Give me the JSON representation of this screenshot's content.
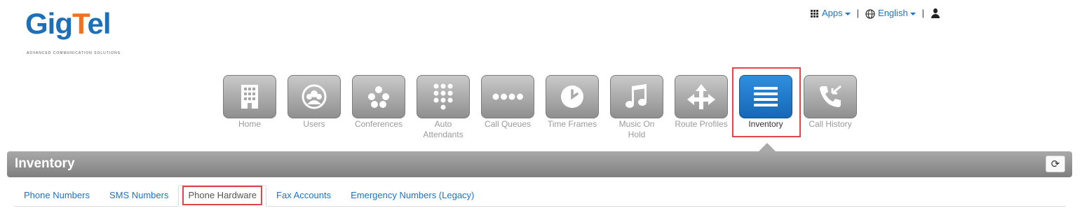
{
  "logo": {
    "word_start": "Gig",
    "word_accent": "T",
    "word_end": "el",
    "tagline": "ADVANCED COMMUNICATION SOLUTIONS"
  },
  "header": {
    "apps_label": "Apps",
    "language_label": "English",
    "separator": "|"
  },
  "nav": {
    "items": [
      {
        "label": "Home",
        "icon": "building-icon"
      },
      {
        "label": "Users",
        "icon": "users-icon"
      },
      {
        "label": "Conferences",
        "icon": "conference-icon"
      },
      {
        "label": "Auto Attendants",
        "icon": "keypad-icon"
      },
      {
        "label": "Call Queues",
        "icon": "queue-icon"
      },
      {
        "label": "Time Frames",
        "icon": "clock-icon"
      },
      {
        "label": "Music On Hold",
        "icon": "music-icon"
      },
      {
        "label": "Route Profiles",
        "icon": "route-icon"
      },
      {
        "label": "Inventory",
        "icon": "list-icon",
        "active": true
      },
      {
        "label": "Call History",
        "icon": "phone-history-icon"
      }
    ]
  },
  "page": {
    "title": "Inventory",
    "refresh_icon": "refresh-icon"
  },
  "tabs": [
    {
      "label": "Phone Numbers"
    },
    {
      "label": "SMS Numbers"
    },
    {
      "label": "Phone Hardware",
      "active": true
    },
    {
      "label": "Fax Accounts"
    },
    {
      "label": "Emergency Numbers (Legacy)"
    }
  ],
  "colors": {
    "accent": "#1a73c8",
    "active_tile": "#1d75c7",
    "highlight": "#e0454b"
  }
}
